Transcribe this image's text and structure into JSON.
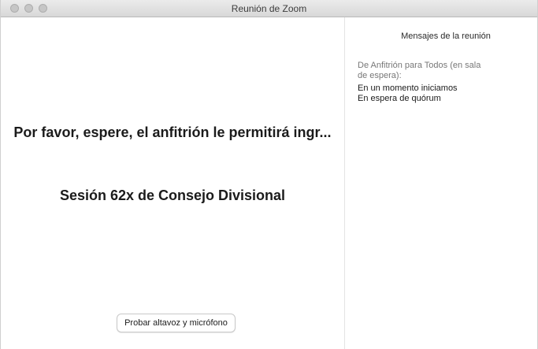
{
  "window": {
    "title": "Reunión de Zoom"
  },
  "main": {
    "waiting_message": "Por favor, espere, el anfitrión le permitirá ingr...",
    "meeting_topic": "Sesión 62x de Consejo Divisional",
    "test_button_label": "Probar altavoz y micrófono"
  },
  "chat": {
    "header": "Mensajes de la reunión",
    "sender": "De Anfitrión para Todos (en sala de espera):",
    "messages": [
      "En un momento iniciamos",
      "En espera de quórum"
    ]
  }
}
